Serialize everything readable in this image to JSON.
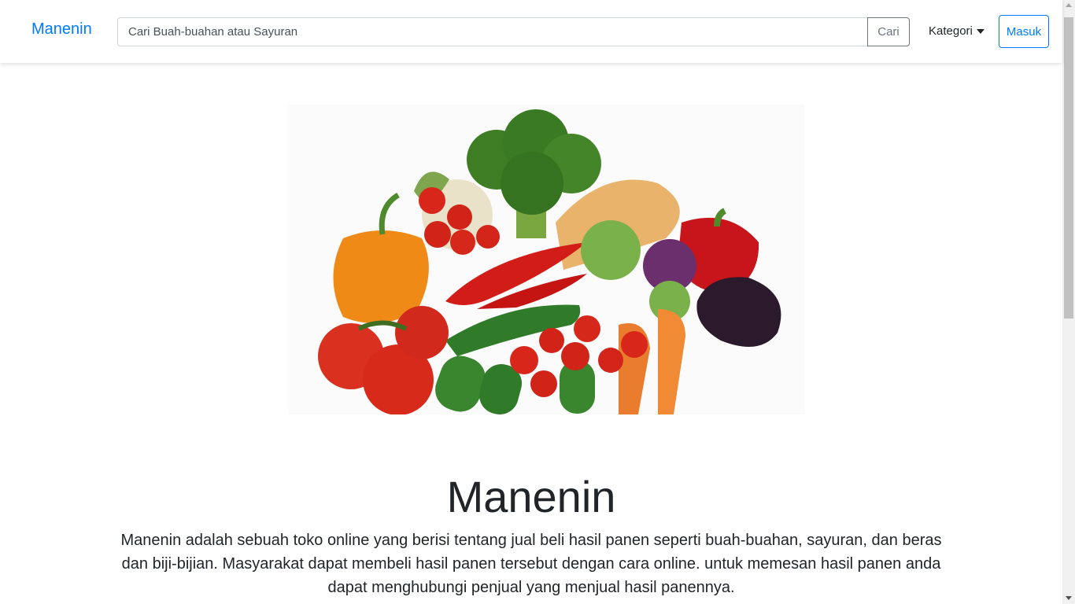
{
  "navbar": {
    "brand": "Manenin",
    "search_placeholder": "Cari Buah-buahan atau Sayuran",
    "search_button": "Cari",
    "category_label": "Kategori",
    "login_button": "Masuk"
  },
  "hero": {
    "image_alt": "vegetables-image"
  },
  "main": {
    "title": "Manenin",
    "description": "Manenin adalah sebuah toko online yang berisi tentang jual beli hasil panen seperti buah-buahan, sayuran, dan beras dan biji-bijian. Masyarakat dapat membeli hasil panen tersebut dengan cara online. untuk memesan hasil panen anda dapat menghubungi penjual yang menjual hasil panennya."
  },
  "colors": {
    "primary": "#007bff",
    "secondary": "#6c757d",
    "text": "#212529"
  },
  "icons": {
    "category_caret": "caret-down-icon"
  }
}
